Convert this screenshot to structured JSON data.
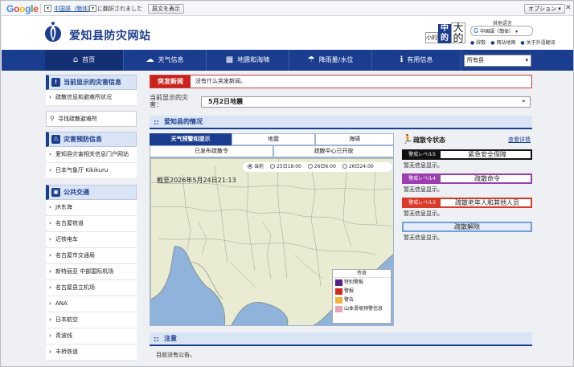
{
  "gbar": {
    "logo_letters": [
      {
        "ch": "G",
        "color": "#4285f4"
      },
      {
        "ch": "o",
        "color": "#ea4335"
      },
      {
        "ch": "o",
        "color": "#fbbc05"
      },
      {
        "ch": "g",
        "color": "#4285f4"
      },
      {
        "ch": "l",
        "color": "#34a853"
      },
      {
        "ch": "e",
        "color": "#ea4335"
      }
    ],
    "lang": "中国語（簡体）",
    "translated_text": "に翻訳されました",
    "show_original": "原文を表示",
    "options": "オプション ▾"
  },
  "header": {
    "site_title": "爱知县防灾网站",
    "font_size": {
      "small": "小的",
      "medium": "中的",
      "large": "大的"
    },
    "lang_caption": "其他语言",
    "translate_select": "中国語（簡体）",
    "links": [
      "辞数",
      "网站地图",
      "关于外语翻译"
    ]
  },
  "nav": {
    "items": [
      {
        "label": "首页",
        "icon": "home-icon",
        "glyph": "⌂",
        "active": true
      },
      {
        "label": "天气信息",
        "icon": "cloud-icon",
        "glyph": "☁",
        "active": false
      },
      {
        "label": "地震和海啸",
        "icon": "map-icon",
        "glyph": "▦",
        "active": false
      },
      {
        "label": "降雨量/水位",
        "icon": "rain-icon",
        "glyph": "☂",
        "active": false
      },
      {
        "label": "有用信息",
        "icon": "info-icon",
        "glyph": "ℹ",
        "active": false
      }
    ],
    "region": "所有县"
  },
  "sidebar": {
    "current_title": "当前显示的灾害信息",
    "current_items": [
      "疏散信息和避难所状况"
    ],
    "search": "寻找疏散避难所",
    "portal_title": "灾害预防信息",
    "portal_items": [
      "爱知县灾害相关信息门户网站",
      "日本气象厅 Kikikuru"
    ],
    "transit_title": "公共交通",
    "transit_items": [
      "JR东海",
      "名古屋铁道",
      "近铁电车",
      "名古屋市交通局",
      "新特丽亚 中部国际机场",
      "名古屋县立机场",
      "ANA",
      "日本航空",
      "青波线",
      "丰桥铁道"
    ]
  },
  "main": {
    "alert_tag": "突发新闻",
    "alert_text": "没有什么突发新闻。",
    "disaster_label": "当前显示的灾害：",
    "disaster_value": "5月2日地震",
    "situation_title": "爱知县的情况",
    "tabs": [
      "天气预警和提示",
      "地震",
      "海啸",
      "已发布疏散令",
      "疏散中心已开放"
    ],
    "radios": [
      "当前",
      "25日18:00",
      "26日6:00",
      "26日24:00"
    ],
    "as_of": "截至2026年5月24日21:13",
    "legend": {
      "title": "传奇",
      "rows": [
        {
          "label": "特别警报",
          "color": "#5b1e8c"
        },
        {
          "label": "警报",
          "color": "#d42a1e"
        },
        {
          "label": "警告",
          "color": "#f2b43d"
        },
        {
          "label": "山体滑坡预警信息",
          "color": "#e7a1b1"
        }
      ]
    },
    "status_title": "疏散令状态",
    "status_more": "查看详情",
    "levels": [
      {
        "badge": "警戒レベル5",
        "text": "紧急安全保障",
        "color": "#111111",
        "none": "暂无信息显示。"
      },
      {
        "badge": "警戒レベル4",
        "text": "疏散命令",
        "color": "#9b3fb0",
        "none": "暂无信息显示。"
      },
      {
        "badge": "警戒レベル3",
        "text": "疏散老年人和其他人员",
        "color": "#d93b2a",
        "none": "暂无信息显示。"
      },
      {
        "badge": "",
        "text": "疏散解除",
        "color": "#6fa0d8",
        "none": "暂无信息显示。"
      }
    ],
    "notice_title": "注意",
    "notice_text": "目前没有公告。"
  }
}
